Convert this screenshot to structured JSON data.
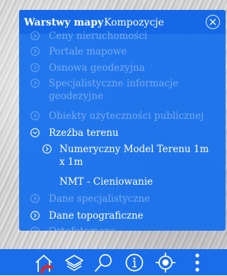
{
  "tabs": {
    "active": "Warstwy mapy",
    "inactive": "Kompozycje"
  },
  "layers": [
    {
      "label": "Ceny nieruchomości",
      "state": "dim"
    },
    {
      "label": "Portale mapowe",
      "state": "dim"
    },
    {
      "label": "Osnowa geodezyjna",
      "state": "dim"
    },
    {
      "label": "Specjalistyczne informacje geodezyjne",
      "state": "dim"
    },
    {
      "label": "Obiekty użyteczności publicznej",
      "state": "dim"
    },
    {
      "label": "Rzeźba terenu",
      "state": "expanded"
    },
    {
      "label": "Numeryczny Model Terenu 1m x 1m",
      "state": "sub"
    },
    {
      "label": "NMT - Cieniowanie",
      "state": "sub-leaf"
    },
    {
      "label": "Dane specjalistyczne",
      "state": "dim"
    },
    {
      "label": "Dane topograficzne",
      "state": "active"
    },
    {
      "label": "Ortofotomapa",
      "state": "dim"
    }
  ],
  "toolbar_icons": [
    "home-icon",
    "layers-icon",
    "search-icon",
    "info-icon",
    "locate-icon",
    "more-icon"
  ],
  "colors": {
    "panel": "#1670ec",
    "header": "#1669e6",
    "toolbar": "#1a6dea",
    "accent_red": "#e0261c"
  }
}
